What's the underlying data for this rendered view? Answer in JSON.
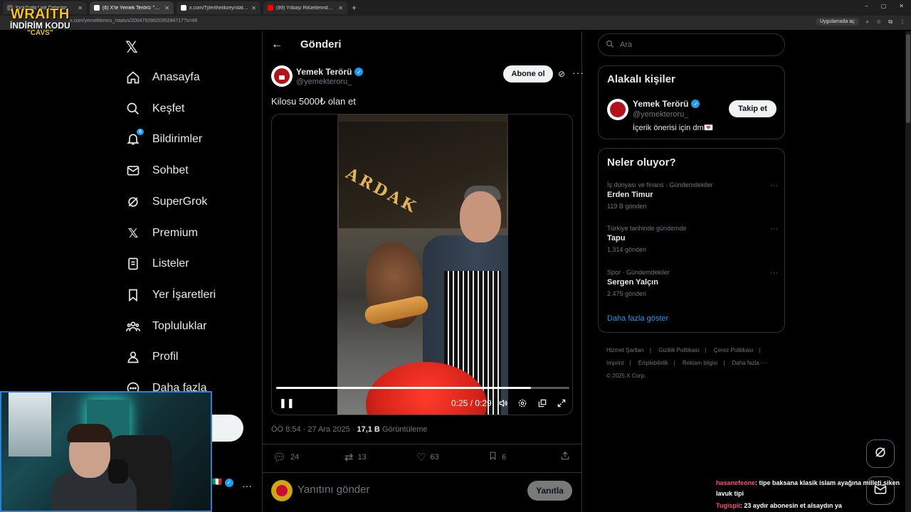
{
  "browser": {
    "tabs": [
      {
        "label": "KickSight Link Detector"
      },
      {
        "label": "(6) X'te Yemek Terörü: \"Kilo..."
      },
      {
        "label": "x.com/Tylerthelilizey/status/20..."
      },
      {
        "label": "(99) Yılbaşı Ritüellerinden Umutsu..."
      }
    ],
    "url": "x.com/yemekteroru_/status/2004792862035284717?s=46",
    "app_chip": "Uygulamada aç"
  },
  "overlay_logo": {
    "line1": "WRAITH",
    "line2": "İNDİRİM KODU",
    "line3": "\"CAVS\""
  },
  "nav": {
    "items": [
      {
        "label": "Anasayfa"
      },
      {
        "label": "Keşfet"
      },
      {
        "label": "Bildirimler",
        "badge": "6"
      },
      {
        "label": "Sohbet"
      },
      {
        "label": "SuperGrok"
      },
      {
        "label": "Premium"
      },
      {
        "label": "Listeler"
      },
      {
        "label": "Yer İşaretleri"
      },
      {
        "label": "Topluluklar"
      },
      {
        "label": "Profil"
      },
      {
        "label": "Daha fazla"
      }
    ],
    "post_button_partial": "a"
  },
  "post": {
    "header_title": "Gönderi",
    "author_name": "Yemek Terörü",
    "author_handle": "@yemekteroru_",
    "follow_label": "Abone ol",
    "text": "Kilosu 5000₺ olan et",
    "video": {
      "sign_text": "ARDAK",
      "current": "0:25",
      "total": "0:29",
      "time_display": "0:25 / 0:29",
      "progress": 0.87
    },
    "meta_time": "ÖÖ 8:54 · 27 Ara 2025 · ",
    "meta_views": "17,1 B",
    "meta_views_label": " Görüntüleme",
    "actions": {
      "replies": "24",
      "reposts": "13",
      "likes": "63",
      "bookmarks": "6"
    },
    "reply_placeholder": "Yanıtını gönder",
    "reply_button": "Yanıtla"
  },
  "sidebar": {
    "search_placeholder": "Ara",
    "related": {
      "title": "Alakalı kişiler",
      "name": "Yemek Terörü",
      "handle": "@yemekteroru_",
      "bio": "İçerik önerisi için dm💌",
      "follow_label": "Takip et"
    },
    "trends": {
      "title": "Neler oluyor?",
      "items": [
        {
          "context": "İş dünyası ve finans · Gündemdekiler",
          "topic": "Erden Timur",
          "count": "119 B gönderi"
        },
        {
          "context": "Türkiye tarihinde gündemde",
          "topic": "Tapu",
          "count": "1.314 gönderi"
        },
        {
          "context": "Spor · Gündemdekiler",
          "topic": "Sergen Yalçın",
          "count": "2.475 gönderi"
        }
      ],
      "show_more": "Daha fazla göster"
    },
    "footer": {
      "links": [
        "Hizmet Şartları",
        "Gizlilik Politikası",
        "Çerez Politikası",
        "Imprint",
        "Erişilebilirlik",
        "Reklam bilgisi",
        "Daha fazla ···"
      ],
      "copyright": "© 2025 X Corp."
    }
  },
  "chat": [
    {
      "user": "hasanefeone",
      "message": ": tipe baksana klasik islam ayağına milleti siken lavuk tipi"
    },
    {
      "user": "Tugispii",
      "message": ": 23 aydır abonesin et alsaydın ya"
    }
  ],
  "colors": {
    "accent": "#1d9bf0",
    "background": "#000000",
    "border": "#2f3336",
    "muted": "#71767b"
  }
}
